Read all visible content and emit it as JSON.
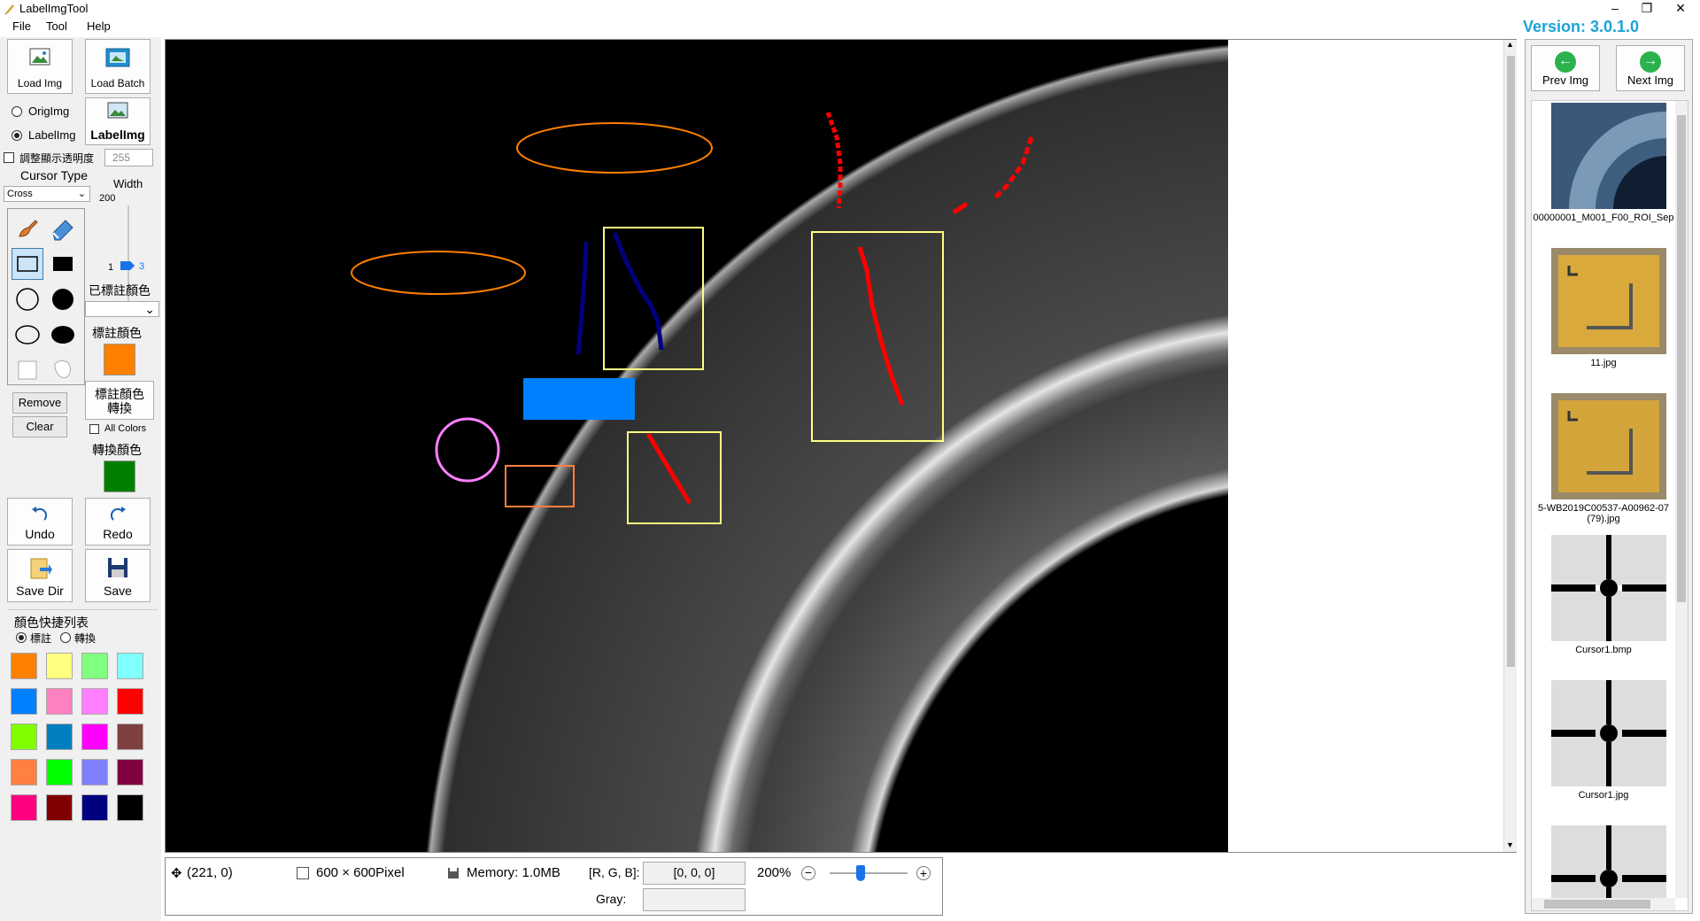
{
  "window": {
    "title": "LabelImgTool",
    "minimize": "–",
    "restore": "❐",
    "close": "✕"
  },
  "menu": [
    "File",
    "Tool",
    "Help"
  ],
  "version": "Version: 3.0.1.0",
  "left": {
    "load_img": "Load Img",
    "load_batch": "Load Batch",
    "orig_img": "OrigImg",
    "label_img_radio": "LabelImg",
    "label_img_button": "LabelImg",
    "opacity_label": "調整顯示透明度",
    "opacity_value": "255",
    "cursor_type_label": "Cursor Type",
    "cursor_type_value": "Cross",
    "width_label": "Width",
    "width_max": "200",
    "width_min": "1",
    "width_value": "3",
    "labeled_color_label": "已標註顏色",
    "label_color_label": "標註顏色",
    "label_color": "#ff8000",
    "convert_label_line1": "標註顏色",
    "convert_label_line2": "轉換",
    "all_colors": "All Colors",
    "convert_color_label": "轉換顏色",
    "convert_color": "#008000",
    "remove": "Remove",
    "clear": "Clear",
    "undo": "Undo",
    "redo": "Redo",
    "save_dir": "Save Dir",
    "save": "Save",
    "shortcut_title": "顏色快捷列表",
    "mode_label": "標註",
    "mode_convert": "轉換",
    "palette": [
      "#ff8000",
      "#ffff80",
      "#80ff80",
      "#80ffff",
      "#0080ff",
      "#ff80c0",
      "#ff80ff",
      "#ff0000",
      "#80ff00",
      "#0080c0",
      "#ff00ff",
      "#804040",
      "#ff8040",
      "#00ff00",
      "#8080ff",
      "#800040",
      "#ff0080",
      "#800000",
      "#000080",
      "#000000"
    ]
  },
  "status": {
    "coords": "(221, 0)",
    "size": "600 × 600Pixel",
    "memory": "Memory: 1.0MB",
    "rgb_label": "[R, G, B]:",
    "rgb_value": "[0, 0, 0]",
    "zoom": "200%",
    "gray_label": "Gray:",
    "gray_value": ""
  },
  "right": {
    "prev": "Prev Img",
    "next": "Next Img",
    "thumbnails": [
      {
        "name": "00000001_M001_F00_ROI_Sep"
      },
      {
        "name": "11.jpg"
      },
      {
        "name": "5-WB2019C00537-A00962-07 (79).jpg"
      },
      {
        "name": "Cursor1.bmp"
      },
      {
        "name": "Cursor1.jpg"
      }
    ]
  }
}
